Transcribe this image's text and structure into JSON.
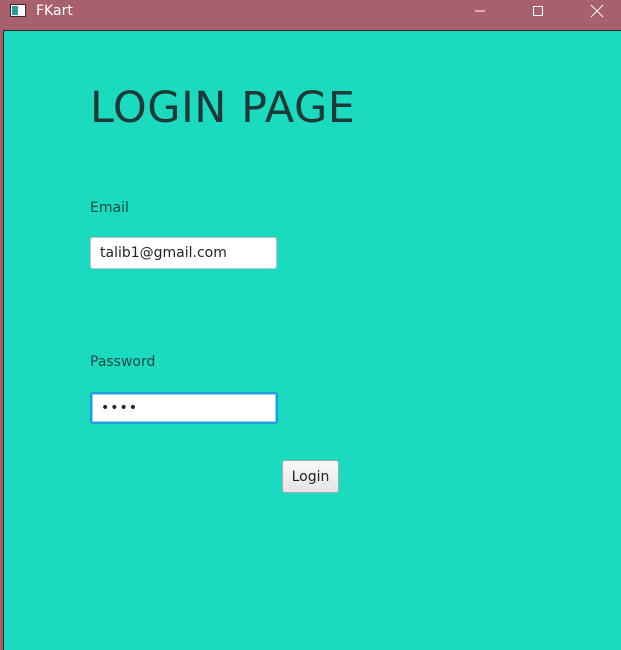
{
  "window": {
    "title": "FKart",
    "icons": {
      "app": "window-app-icon",
      "minimize": "minimize-icon",
      "maximize": "maximize-icon",
      "close": "close-icon"
    }
  },
  "colors": {
    "titlebar": "#a8606c",
    "background": "#1adbc0",
    "focus_ring": "#1e9ee0"
  },
  "login": {
    "heading": "LOGIN PAGE",
    "email_label": "Email",
    "email_value": "talib1@gmail.com",
    "password_label": "Password",
    "password_value": "abcd",
    "login_label": "Login"
  }
}
